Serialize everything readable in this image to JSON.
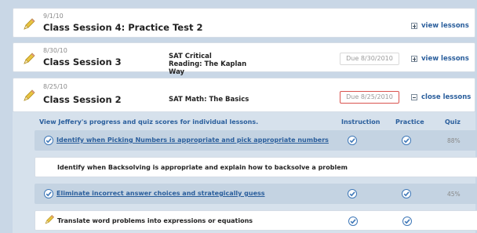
{
  "sessions": [
    {
      "date": "9/1/10",
      "title": "Class Session 4: Practice Test 2",
      "subject": "",
      "due": "",
      "toggle_label": "view lessons",
      "toggle_state": "collapsed"
    },
    {
      "date": "8/30/10",
      "title": "Class Session 3",
      "subject": "SAT Critical Reading: The Kaplan Way",
      "due": "Due 8/30/2010",
      "toggle_label": "view lessons",
      "toggle_state": "collapsed"
    },
    {
      "date": "8/25/10",
      "title": "Class Session 2",
      "subject": "SAT Math: The Basics",
      "due": "Due 8/25/2010",
      "due_alert": true,
      "toggle_label": "close lessons",
      "toggle_state": "expanded"
    }
  ],
  "lessons_panel": {
    "intro": "View Jeffery's progress and quiz scores for individual lessons.",
    "columns": [
      "Instruction",
      "Practice",
      "Quiz"
    ],
    "lessons": [
      {
        "status_icon": "check-circle-icon",
        "text": "Identify when Picking Numbers is appropriate and pick appropriate numbers",
        "is_link": true,
        "instruction": "check",
        "practice": "check",
        "quiz": "88%"
      },
      {
        "status_icon": "",
        "text": "Identify when Backsolving is appropriate and explain how to backsolve a problem",
        "is_link": false,
        "instruction": "",
        "practice": "",
        "quiz": ""
      },
      {
        "status_icon": "check-circle-icon",
        "text": "Eliminate incorrect answer choices and strategically guess",
        "is_link": true,
        "instruction": "check",
        "practice": "check",
        "quiz": "45%"
      },
      {
        "status_icon": "pencil-icon",
        "text": "Translate word problems into expressions or equations",
        "is_link": false,
        "instruction": "check",
        "practice": "check",
        "quiz": ""
      }
    ]
  },
  "colors": {
    "background": "#c9d7e6",
    "panel": "#d6e1ec",
    "link": "#2a5e9c",
    "alert_border": "#d9534f",
    "check": "#3f78b8",
    "pencil": "#e8c341"
  }
}
